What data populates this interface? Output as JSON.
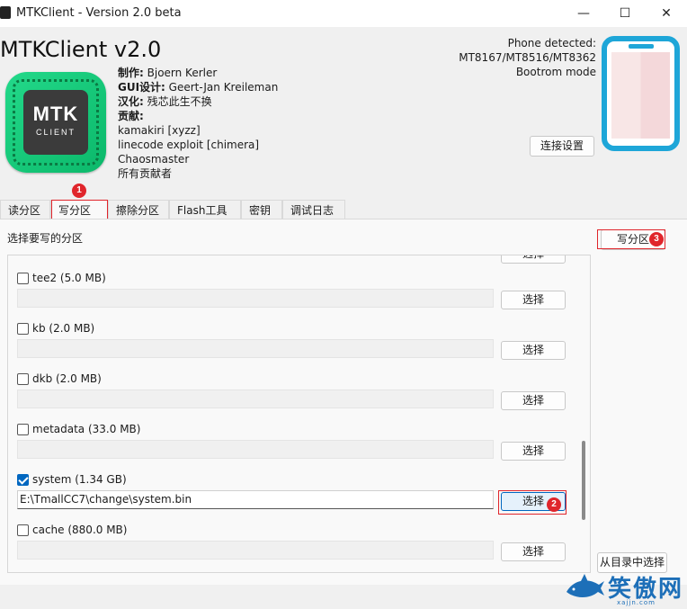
{
  "window": {
    "title": "MTKClient - Version 2.0 beta",
    "minimize": "—",
    "maximize": "☐",
    "close": "✕"
  },
  "app": {
    "heading": "MTKClient v2.0",
    "logo_text": "MTK",
    "logo_sub": "CLIENT"
  },
  "credits": {
    "author_label": "制作:",
    "author": " Bjoern Kerler",
    "gui_label": "GUI设计:",
    "gui": " Geert-Jan Kreileman",
    "cn_label": "汉化:",
    "cn": " 残芯此生不换",
    "contrib_label": "贡献:",
    "contrib_1": "kamakiri [xyzz]",
    "contrib_2": "linecode exploit [chimera]",
    "contrib_3": "Chaosmaster",
    "contrib_4": "所有贡献者"
  },
  "phone": {
    "line1": "Phone detected:",
    "line2": "MT8167/MT8516/MT8362",
    "line3": "Bootrom mode",
    "connect_btn": "连接设置"
  },
  "tabs": [
    {
      "label": "读分区"
    },
    {
      "label": "写分区"
    },
    {
      "label": "擦除分区"
    },
    {
      "label": "Flash工具"
    },
    {
      "label": "密钥"
    },
    {
      "label": "调试日志"
    }
  ],
  "panel": {
    "select_label": "选择要写的分区",
    "write_btn": "写分区",
    "from_dir_btn": "从目录中选择"
  },
  "partitions": [
    {
      "name": "tee2 (5.0 MB)",
      "checked": false,
      "path": "",
      "btn": "选择"
    },
    {
      "name": "kb (2.0 MB)",
      "checked": false,
      "path": "",
      "btn": "选择"
    },
    {
      "name": "dkb (2.0 MB)",
      "checked": false,
      "path": "",
      "btn": "选择"
    },
    {
      "name": "metadata (33.0 MB)",
      "checked": false,
      "path": "",
      "btn": "选择"
    },
    {
      "name": "system (1.34 GB)",
      "checked": true,
      "path": "E:\\TmallCC7\\change\\system.bin",
      "btn": "选择"
    },
    {
      "name": "cache (880.0 MB)",
      "checked": false,
      "path": "",
      "btn": "选择"
    }
  ],
  "top_partial_btn": "选择",
  "annotations": {
    "b1": "1",
    "b2": "2",
    "b3": "3",
    "accent": "#e0252b"
  },
  "watermark": {
    "text": "笑傲网",
    "sub": "xajjn.com"
  }
}
